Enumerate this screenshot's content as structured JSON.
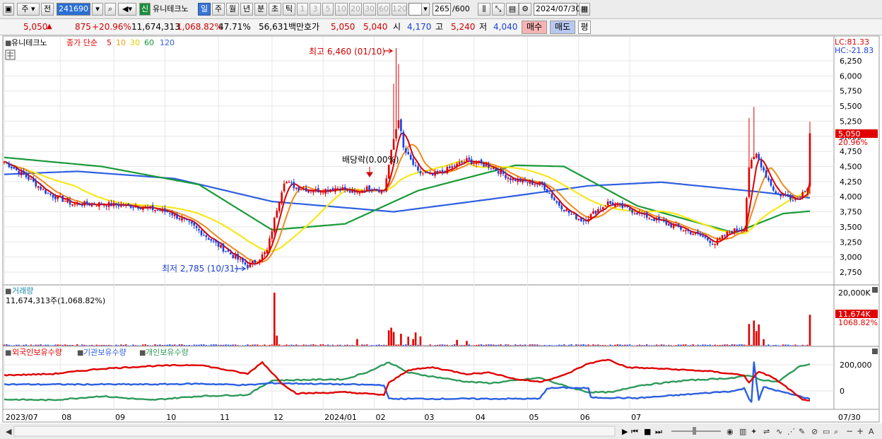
{
  "toolbar": {
    "period_unit": "주",
    "prev_label": "전",
    "code": "241690",
    "new_badge": "신",
    "stock_name": "유니테크노",
    "periods": [
      "일",
      "주",
      "월",
      "년",
      "분",
      "초",
      "틱"
    ],
    "active_period": "일",
    "minute_steps": [
      "1",
      "3",
      "5",
      "10",
      "20",
      "30",
      "60",
      "120"
    ],
    "count_value": "265",
    "count_max": "/600",
    "date": "2024/07/30"
  },
  "quote": {
    "price": "5,050",
    "change": "875",
    "change_pct": "+20.96%",
    "volume": "11,674,313",
    "volume_ratio": "1,068.82%",
    "turnover": "47.71%",
    "amount": "56,631백만",
    "bid_label": "호가",
    "ask_price": "5,050",
    "bid_price": "5,040",
    "open_label": "시",
    "open": "4,170",
    "high_label": "고",
    "high": "5,240",
    "low_label": "저",
    "low": "4,040",
    "buy_label": "매수",
    "sell_label": "매도",
    "avg_label": "평"
  },
  "colors": {
    "candle_up": "#e00000",
    "candle_down": "#1a3fe0",
    "ma5": "#dd0000",
    "ma10": "#f08a1c",
    "ma30": "#f7e81a",
    "ma60": "#1a9a38",
    "ma120": "#2e5fe0",
    "foreign": "#e00000",
    "institution": "#2a5fe0",
    "individual": "#2e9a5a"
  },
  "chart_data": [
    {
      "type": "candlestick",
      "legend": {
        "stock": "유니테크노",
        "price_label": "종가 단순",
        "ma": [
          "5",
          "10",
          "30",
          "60",
          "120"
        ]
      },
      "y_ticks": [
        "6,250",
        "6,000",
        "5,750",
        "5,500",
        "5,250",
        "5,000",
        "4,750",
        "4,500",
        "4,250",
        "4,000",
        "3,750",
        "3,500",
        "3,250",
        "3,000",
        "2,750"
      ],
      "ylim": [
        2650,
        6400
      ],
      "scale_top": [
        "LC:81.33",
        "HC:-21.83"
      ],
      "last_price_tag": "5,050",
      "last_change_tag": "20.96%",
      "x_labels": [
        "2023/07",
        "08",
        "09",
        "10",
        "11",
        "12",
        "2024/01",
        "02",
        "03",
        "04",
        "05",
        "06",
        "07"
      ],
      "x_end_label": "07/30",
      "annotations": {
        "high": "최고 6,460 (01/10)",
        "low": "최저 2,785 (10/31)",
        "dividend": "배당락(0.00%)"
      },
      "close_keyframes": [
        [
          0,
          4580
        ],
        [
          10,
          4300
        ],
        [
          18,
          4050
        ],
        [
          28,
          3880
        ],
        [
          40,
          3880
        ],
        [
          55,
          3840
        ],
        [
          68,
          3740
        ],
        [
          78,
          3500
        ],
        [
          86,
          3250
        ],
        [
          94,
          3020
        ],
        [
          100,
          2850
        ],
        [
          104,
          2950
        ],
        [
          108,
          3100
        ],
        [
          112,
          3800
        ],
        [
          115,
          4260
        ],
        [
          120,
          4150
        ],
        [
          128,
          4100
        ],
        [
          138,
          4150
        ],
        [
          144,
          4050
        ],
        [
          150,
          4150
        ],
        [
          156,
          4100
        ],
        [
          160,
          4950
        ],
        [
          162,
          5300
        ],
        [
          164,
          4800
        ],
        [
          170,
          4400
        ],
        [
          176,
          4350
        ],
        [
          182,
          4450
        ],
        [
          190,
          4600
        ],
        [
          200,
          4500
        ],
        [
          208,
          4300
        ],
        [
          215,
          4240
        ],
        [
          221,
          4200
        ],
        [
          227,
          3900
        ],
        [
          233,
          3700
        ],
        [
          238,
          3600
        ],
        [
          243,
          3760
        ],
        [
          248,
          3900
        ],
        [
          256,
          3800
        ],
        [
          266,
          3640
        ],
        [
          276,
          3500
        ],
        [
          286,
          3350
        ],
        [
          292,
          3230
        ],
        [
          298,
          3420
        ],
        [
          304,
          3480
        ],
        [
          306,
          4500
        ],
        [
          309,
          4700
        ],
        [
          313,
          4350
        ],
        [
          317,
          4050
        ],
        [
          322,
          4000
        ],
        [
          326,
          3960
        ],
        [
          330,
          4170
        ],
        [
          331,
          5050
        ]
      ],
      "ma60_keyframes": [
        [
          0,
          4650
        ],
        [
          40,
          4500
        ],
        [
          80,
          4200
        ],
        [
          110,
          3450
        ],
        [
          140,
          3550
        ],
        [
          170,
          4100
        ],
        [
          210,
          4520
        ],
        [
          230,
          4500
        ],
        [
          260,
          3850
        ],
        [
          300,
          3400
        ],
        [
          320,
          3720
        ],
        [
          331,
          3760
        ]
      ],
      "ma120_keyframes": [
        [
          0,
          4370
        ],
        [
          30,
          4420
        ],
        [
          70,
          4300
        ],
        [
          110,
          3920
        ],
        [
          160,
          3750
        ],
        [
          200,
          3960
        ],
        [
          240,
          4180
        ],
        [
          270,
          4240
        ],
        [
          310,
          4080
        ],
        [
          331,
          3980
        ]
      ]
    },
    {
      "type": "bar",
      "title": "거래량",
      "value_text": "11,674,313주(1,068.82%)",
      "y_tick": "20,000K",
      "last_tag": "11,674K",
      "last_pct_tag": "1068.82%",
      "spikes": [
        [
          111,
          20000
        ],
        [
          112,
          3800
        ],
        [
          145,
          2500
        ],
        [
          158,
          5800
        ],
        [
          159,
          6800
        ],
        [
          160,
          5200
        ],
        [
          163,
          4500
        ],
        [
          166,
          3400
        ],
        [
          168,
          2500
        ],
        [
          169,
          5000
        ],
        [
          171,
          3500
        ],
        [
          186,
          2200
        ],
        [
          190,
          1800
        ],
        [
          306,
          8200
        ],
        [
          308,
          9500
        ],
        [
          309,
          5500
        ],
        [
          310,
          8000
        ],
        [
          312,
          2500
        ],
        [
          331,
          11674
        ]
      ]
    },
    {
      "type": "line",
      "legend": [
        "외국인보유수량",
        "기관보유수량",
        "개인보유수량"
      ],
      "y_ticks": [
        "200,000",
        "0"
      ],
      "ylim": [
        -80000,
        250000
      ],
      "foreign_keyframes": [
        [
          0,
          120000
        ],
        [
          20,
          130000
        ],
        [
          40,
          170000
        ],
        [
          60,
          190000
        ],
        [
          80,
          200000
        ],
        [
          100,
          130000
        ],
        [
          106,
          220000
        ],
        [
          114,
          60000
        ],
        [
          120,
          -20000
        ],
        [
          140,
          -10000
        ],
        [
          156,
          -30000
        ],
        [
          158,
          60000
        ],
        [
          166,
          160000
        ],
        [
          176,
          180000
        ],
        [
          190,
          130000
        ],
        [
          200,
          140000
        ],
        [
          210,
          90000
        ],
        [
          220,
          70000
        ],
        [
          230,
          120000
        ],
        [
          240,
          210000
        ],
        [
          248,
          240000
        ],
        [
          256,
          180000
        ],
        [
          270,
          170000
        ],
        [
          290,
          150000
        ],
        [
          304,
          120000
        ],
        [
          306,
          60000
        ],
        [
          310,
          150000
        ],
        [
          316,
          100000
        ],
        [
          322,
          20000
        ],
        [
          328,
          -70000
        ],
        [
          331,
          -70000
        ]
      ],
      "institution_keyframes": [
        [
          0,
          50000
        ],
        [
          60,
          50000
        ],
        [
          80,
          55000
        ],
        [
          100,
          45000
        ],
        [
          110,
          60000
        ],
        [
          156,
          45000
        ],
        [
          158,
          -60000
        ],
        [
          166,
          -60000
        ],
        [
          210,
          -60000
        ],
        [
          220,
          -60000
        ],
        [
          223,
          20000
        ],
        [
          230,
          25000
        ],
        [
          240,
          20000
        ],
        [
          241,
          -50000
        ],
        [
          260,
          -55000
        ],
        [
          300,
          0
        ],
        [
          304,
          20000
        ],
        [
          306,
          -60000
        ],
        [
          307,
          -80000
        ],
        [
          308,
          220000
        ],
        [
          310,
          -70000
        ],
        [
          312,
          30000
        ],
        [
          320,
          -10000
        ],
        [
          331,
          -60000
        ]
      ],
      "individual_keyframes": [
        [
          0,
          -65000
        ],
        [
          20,
          -70000
        ],
        [
          40,
          -40000
        ],
        [
          60,
          -70000
        ],
        [
          80,
          -40000
        ],
        [
          100,
          -30000
        ],
        [
          110,
          80000
        ],
        [
          140,
          90000
        ],
        [
          150,
          150000
        ],
        [
          158,
          220000
        ],
        [
          166,
          140000
        ],
        [
          176,
          110000
        ],
        [
          190,
          70000
        ],
        [
          200,
          60000
        ],
        [
          210,
          80000
        ],
        [
          220,
          100000
        ],
        [
          230,
          40000
        ],
        [
          240,
          -10000
        ],
        [
          250,
          -10000
        ],
        [
          260,
          40000
        ],
        [
          280,
          80000
        ],
        [
          300,
          100000
        ],
        [
          306,
          120000
        ],
        [
          312,
          80000
        ],
        [
          318,
          70000
        ],
        [
          326,
          180000
        ],
        [
          331,
          210000
        ]
      ]
    }
  ]
}
